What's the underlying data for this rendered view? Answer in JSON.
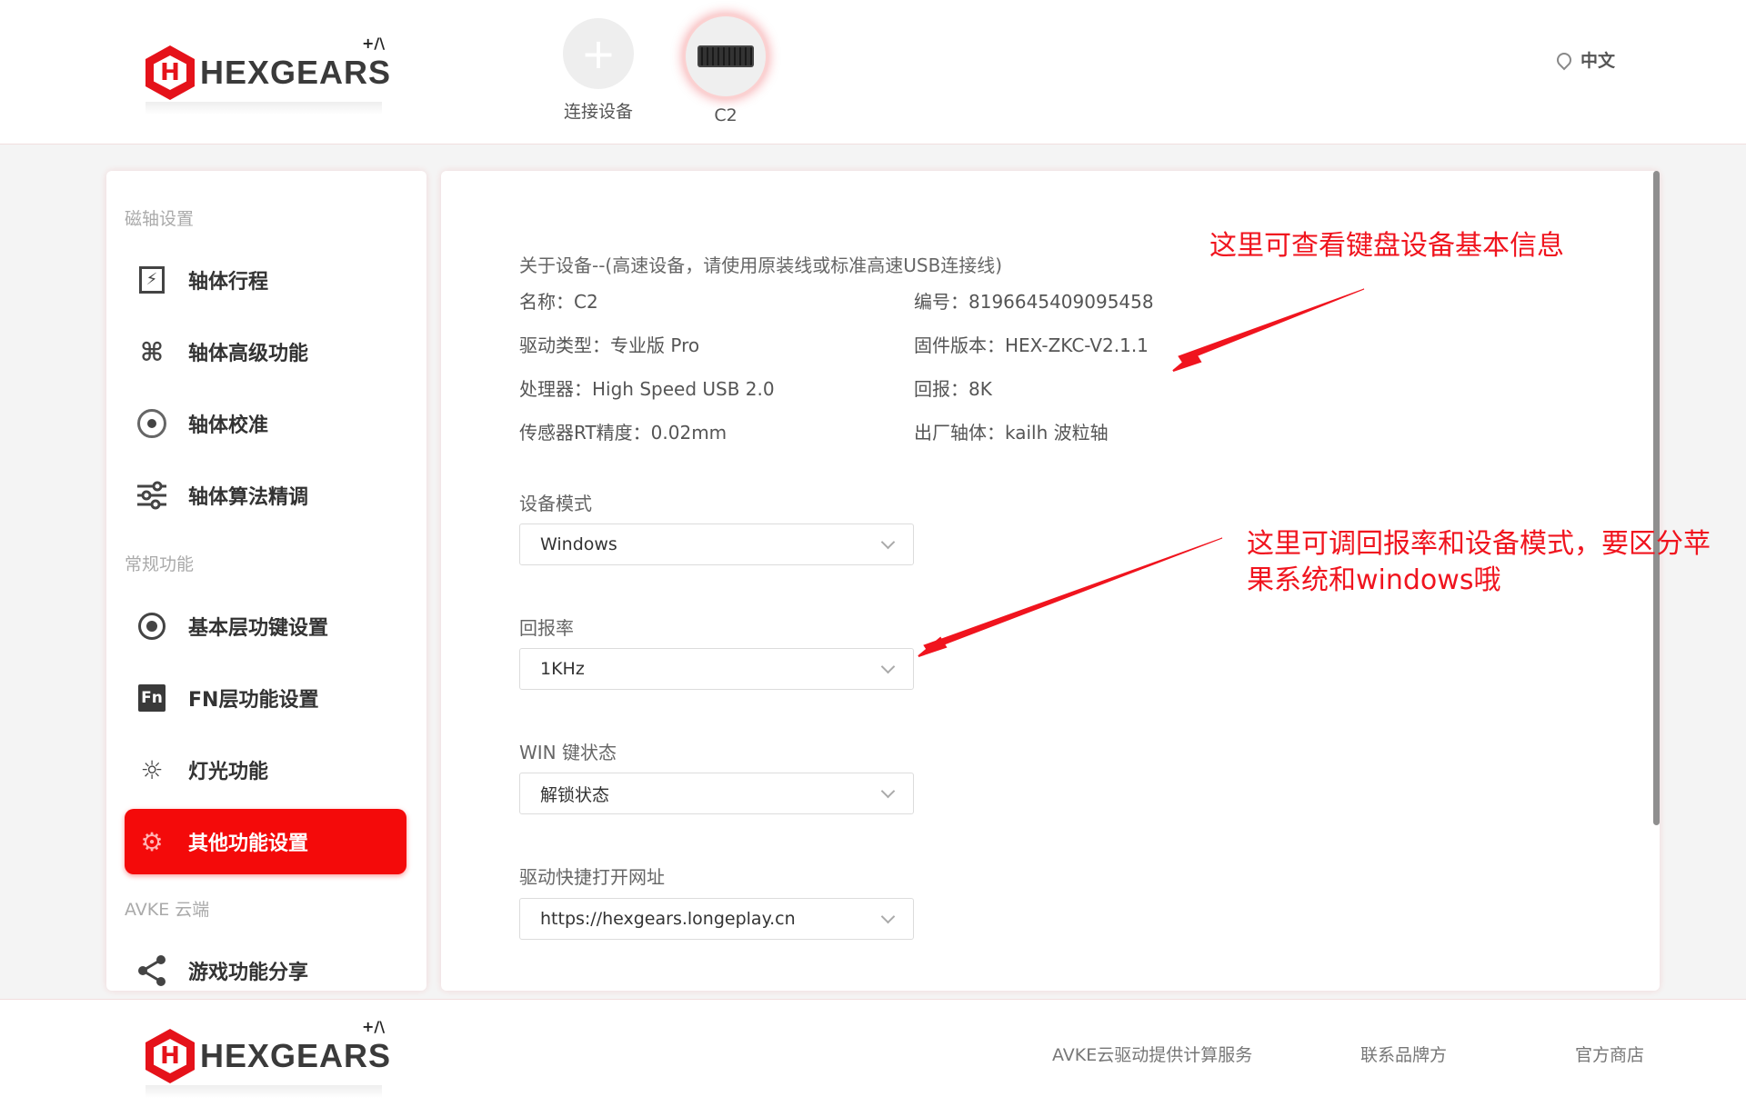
{
  "brand": {
    "name": "HEXGEARS",
    "sup": "+/\\"
  },
  "devices": [
    {
      "label": "连接设备"
    },
    {
      "label": "C2"
    }
  ],
  "language": "中文",
  "sidebar": {
    "section1": "磁轴设置",
    "section2": "常规功能",
    "section3": "AVKE 云端",
    "items": [
      {
        "label": "轴体行程",
        "icon": "travel-icon"
      },
      {
        "label": "轴体高级功能",
        "icon": "command-icon"
      },
      {
        "label": "轴体校准",
        "icon": "calibration-icon"
      },
      {
        "label": "轴体算法精调",
        "icon": "sliders-icon"
      },
      {
        "label": "基本层功键设置",
        "icon": "record-icon"
      },
      {
        "label": "FN层功能设置",
        "icon": "fn-icon",
        "glyph": "Fn"
      },
      {
        "label": "灯光功能",
        "icon": "light-icon"
      },
      {
        "label": "其他功能设置",
        "icon": "gear-icon"
      },
      {
        "label": "游戏功能分享",
        "icon": "share-icon"
      }
    ]
  },
  "info": {
    "title": "关于设备--(高速设备，请使用原装线或标准高速USB连接线)",
    "name": "名称：C2",
    "serial": "编号：8196645409095458",
    "driver": "驱动类型：专业版 Pro",
    "firmware": "固件版本：HEX-ZKC-V2.1.1",
    "processor": "处理器：High Speed USB 2.0",
    "report": "回报：8K",
    "precision": "传感器RT精度：0.02mm",
    "switch": "出厂轴体：kailh 波粒轴"
  },
  "fields": {
    "mode_label": "设备模式",
    "mode_value": "Windows",
    "rate_label": "回报率",
    "rate_value": "1KHz",
    "win_label": "WIN 键状态",
    "win_value": "解锁状态",
    "url_label": "驱动快捷打开网址",
    "url_value": "https://hexgears.longeplay.cn"
  },
  "annotations": {
    "a1": "这里可查看键盘设备基本信息",
    "a2_line1": "这里可调回报率和设备模式，要区分苹",
    "a2_line2": "果系统和windows哦"
  },
  "footer": {
    "link1": "AVKE云驱动提供计算服务",
    "link2": "联系品牌方",
    "link3": "官方商店"
  },
  "colors": {
    "accent": "#f40a0a",
    "annotation": "#f0141e"
  }
}
